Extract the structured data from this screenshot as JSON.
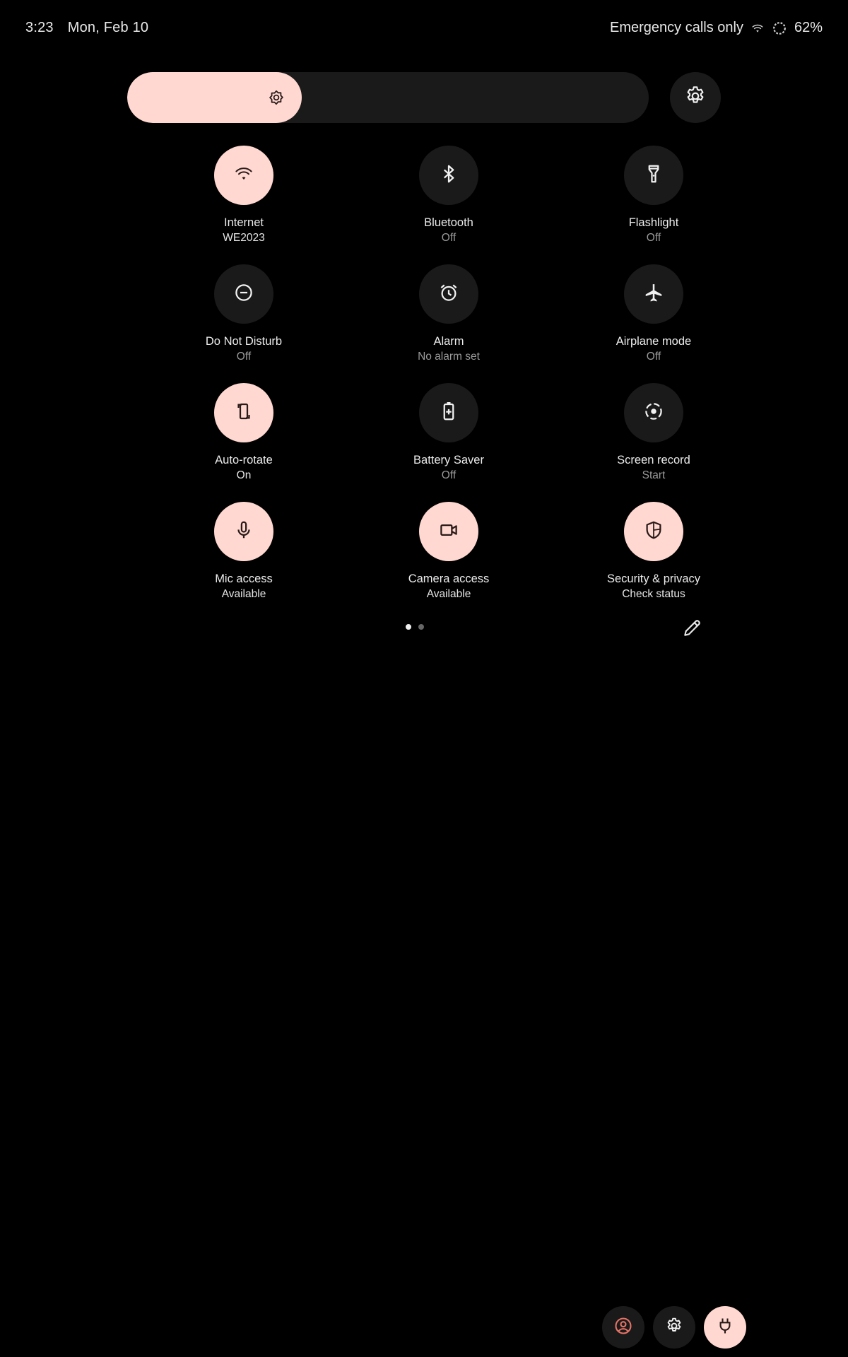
{
  "status_bar": {
    "time": "3:23",
    "date": "Mon, Feb 10",
    "network_text": "Emergency calls only",
    "battery_percent": "62%",
    "wifi_icon": "wifi-icon",
    "battery_icon": "battery-ring-icon"
  },
  "brightness": {
    "level": 0.26,
    "icon": "brightness-icon",
    "settings_icon": "gear-icon"
  },
  "tiles": [
    {
      "label": "Internet",
      "sub": "WE2023",
      "icon": "wifi-icon",
      "active": true
    },
    {
      "label": "Bluetooth",
      "sub": "Off",
      "icon": "bluetooth-icon",
      "active": false
    },
    {
      "label": "Flashlight",
      "sub": "Off",
      "icon": "flashlight-icon",
      "active": false
    },
    {
      "label": "Do Not Disturb",
      "sub": "Off",
      "icon": "do-not-disturb-icon",
      "active": false
    },
    {
      "label": "Alarm",
      "sub": "No alarm set",
      "icon": "alarm-icon",
      "active": false
    },
    {
      "label": "Airplane mode",
      "sub": "Off",
      "icon": "airplane-icon",
      "active": false
    },
    {
      "label": "Auto-rotate",
      "sub": "On",
      "icon": "auto-rotate-icon",
      "active": true
    },
    {
      "label": "Battery Saver",
      "sub": "Off",
      "icon": "battery-saver-icon",
      "active": false
    },
    {
      "label": "Screen record",
      "sub": "Start",
      "icon": "screen-record-icon",
      "active": false
    },
    {
      "label": "Mic access",
      "sub": "Available",
      "icon": "mic-icon",
      "active": true
    },
    {
      "label": "Camera access",
      "sub": "Available",
      "icon": "camera-icon",
      "active": true
    },
    {
      "label": "Security & privacy",
      "sub": "Check status",
      "icon": "shield-icon",
      "active": true
    }
  ],
  "pager": {
    "pages": 2,
    "current": 1
  },
  "edit_icon": "pencil-icon",
  "bottom_actions": [
    {
      "icon": "user-icon",
      "accent": false
    },
    {
      "icon": "gear-icon",
      "accent": false
    },
    {
      "icon": "power-plug-icon",
      "accent": true
    }
  ],
  "colors": {
    "accent": "#ffd8d1",
    "tile_off": "#1a1a1a",
    "background": "#000000",
    "icon_on": "#2a1a18",
    "icon_off": "#f2f2f2",
    "user_icon": "#e57367"
  }
}
